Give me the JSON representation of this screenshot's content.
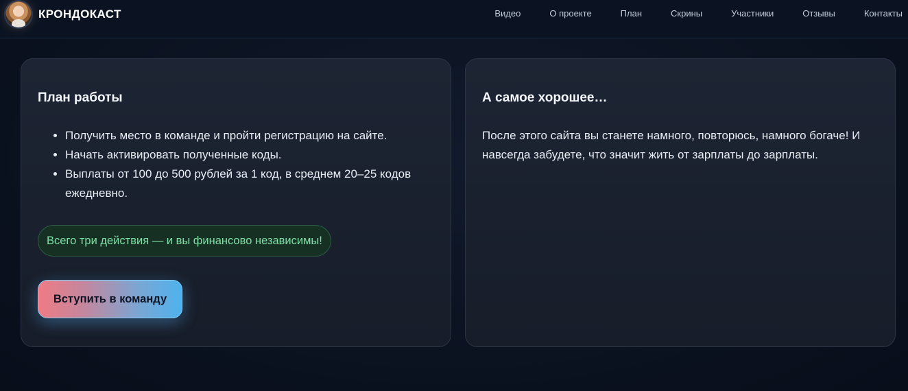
{
  "header": {
    "brand_name": "КРОНДОКАСТ",
    "nav": [
      "Видео",
      "О проекте",
      "План",
      "Скрины",
      "Участники",
      "Отзывы",
      "Контакты"
    ]
  },
  "plan_card": {
    "title": "План работы",
    "items": [
      "Получить место в команде и пройти регистрацию на сайте.",
      "Начать активировать полученные коды.",
      "Выплаты от 100 до 500 рублей за 1 код, в среднем 20–25 кодов ежедневно."
    ],
    "badge": "Всего три действия — и вы финансово независимы!",
    "cta_label": "Вступить в команду"
  },
  "best_card": {
    "title": "А самое хорошее…",
    "text": "После этого сайта вы станете намного, повторюсь, намного богаче! И навсегда забудете, что значит жить от зарплаты до зарплаты."
  },
  "colors": {
    "accent_green": "#7fe0a6",
    "cta_start": "#ef7b85",
    "cta_end": "#4fb2ee",
    "background": "#0b1220"
  }
}
